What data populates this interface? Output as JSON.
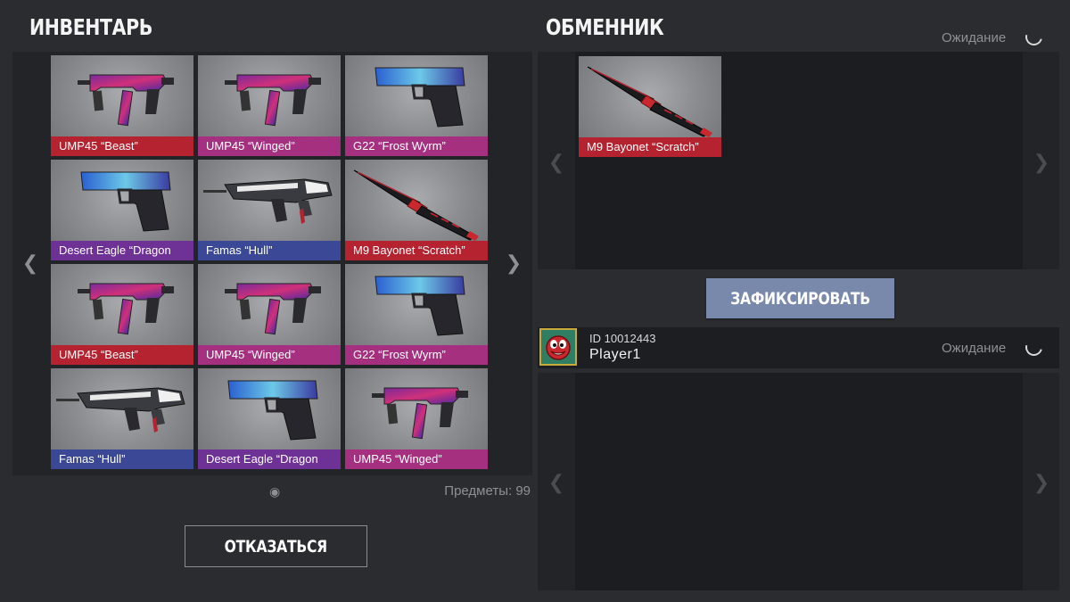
{
  "inventory": {
    "title": "ИНВЕНТАРЬ",
    "prev_arrow": "❮",
    "next_arrow": "❯",
    "page_dot": "◉",
    "items_count": "Предметы: 99",
    "cancel_label": "ОТКАЗАТЬСЯ",
    "items": [
      {
        "label": "UMP45 “Beast”",
        "rarity": "red",
        "icon": "smg-icon"
      },
      {
        "label": "UMP45 “Winged”",
        "rarity": "purple",
        "icon": "smg-icon"
      },
      {
        "label": "G22 “Frost Wyrm”",
        "rarity": "purple",
        "icon": "pistol-icon"
      },
      {
        "label": "Desert Eagle “Dragon",
        "rarity": "violet",
        "icon": "pistol-icon"
      },
      {
        "label": "Famas “Hull”",
        "rarity": "blue",
        "icon": "rifle-icon"
      },
      {
        "label": "M9 Bayonet “Scratch”",
        "rarity": "red",
        "icon": "knife-icon"
      },
      {
        "label": "UMP45 “Beast”",
        "rarity": "red",
        "icon": "smg-icon"
      },
      {
        "label": "UMP45 “Winged”",
        "rarity": "purple",
        "icon": "smg-icon"
      },
      {
        "label": "G22 “Frost Wyrm”",
        "rarity": "purple",
        "icon": "pistol-icon"
      },
      {
        "label": "Famas “Hull”",
        "rarity": "blue",
        "icon": "rifle-icon"
      },
      {
        "label": "Desert Eagle “Dragon",
        "rarity": "violet",
        "icon": "pistol-icon"
      },
      {
        "label": "UMP45 “Winged”",
        "rarity": "purple",
        "icon": "smg-icon"
      }
    ]
  },
  "exchange": {
    "title": "ОБМЕННИК",
    "status": "Ожидание",
    "prev_arrow": "❮",
    "next_arrow": "❯",
    "offered_item": {
      "label": "M9 Bayonet “Scratch”",
      "rarity": "red",
      "icon": "knife-icon"
    },
    "confirm_label": "ЗАФИКСИРОВАТЬ",
    "partner": {
      "id_text": "ID 10012443",
      "name": "Player1",
      "status": "Ожидание",
      "avatar_icon": "red-smiley-avatar-icon"
    }
  },
  "colors": {
    "background": "#2b2c30",
    "panel": "#232428",
    "rarity_red": "#b4232f",
    "rarity_purple": "#a5307f",
    "rarity_violet": "#6e3196",
    "rarity_blue": "#3b4896",
    "confirm_button": "#7889ab"
  }
}
